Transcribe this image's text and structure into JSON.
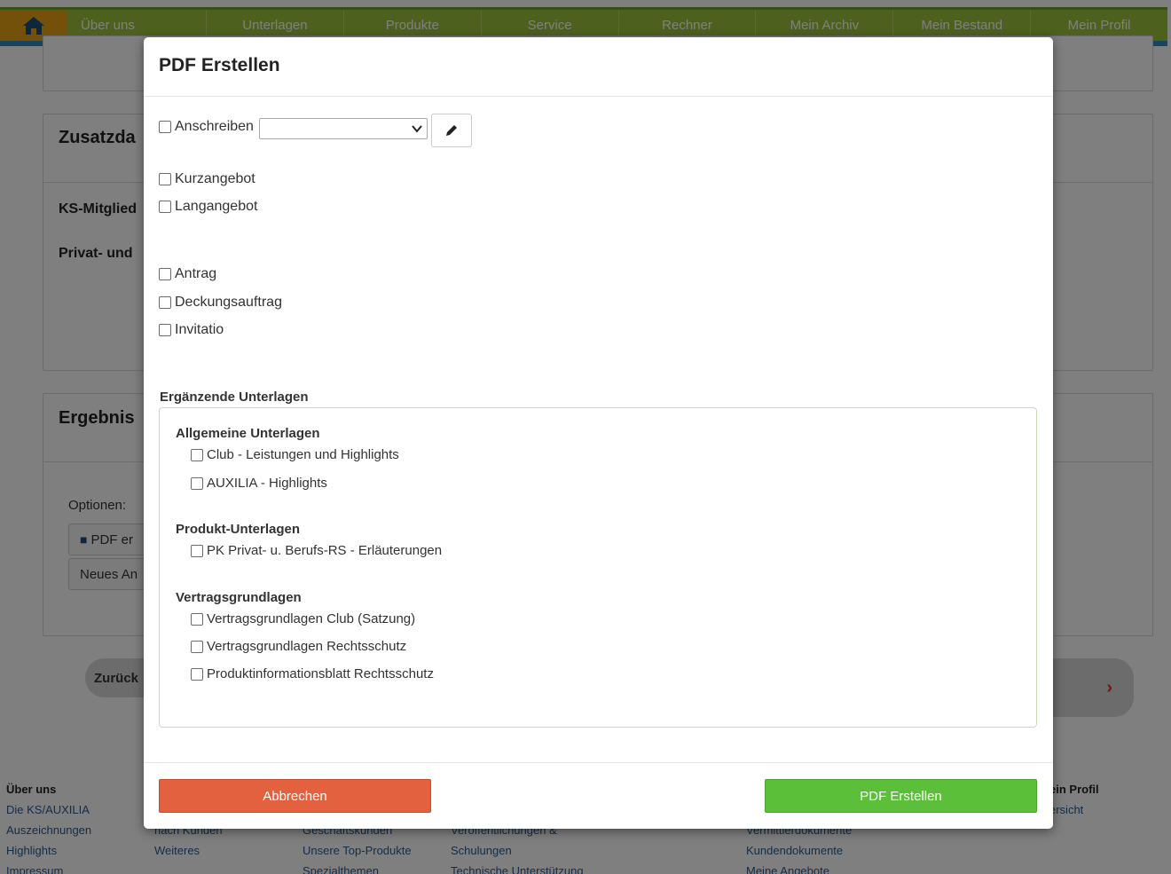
{
  "nav": {
    "items": [
      "Über uns",
      "Unterlagen",
      "Produkte",
      "Service",
      "Rechner",
      "Mein Archiv",
      "Mein Bestand",
      "Mein Profil"
    ]
  },
  "background": {
    "zusatz_heading": "Zusatzda",
    "ks_mitglied": "KS-Mitglied",
    "privat_und": "Privat- und",
    "ergebnis_heading": "Ergebnis",
    "optionen": "Optionen:",
    "pdf_btn": "PDF er",
    "neues_btn": "Neues An",
    "zurueck": "Zurück",
    "arrow": "›"
  },
  "footer": {
    "col1": {
      "heading": "Über uns",
      "links": [
        "Die KS/AUXILIA",
        "Auszeichnungen",
        "Highlights",
        "Impressum"
      ]
    },
    "col2": {
      "links": [
        "nach Kunden",
        "Weiteres"
      ]
    },
    "col3": {
      "links": [
        "Geschäftskunden",
        "Unsere Top-Produkte",
        "Spezialthemen"
      ]
    },
    "col4": {
      "links": [
        "Veröffentlichungen &",
        "Schulungen",
        "Technische Unterstützung"
      ]
    },
    "col5": {
      "links": [
        "Vermittlerdokumente",
        "Kundendokumente",
        "Meine Angebote"
      ]
    },
    "col6": {
      "heading": "ein Profil",
      "links": [
        "ersicht"
      ]
    }
  },
  "modal": {
    "title": "PDF Erstellen",
    "anschreiben_label": "Anschreiben",
    "anschreiben_value": "",
    "options_a": [
      "Kurzangebot",
      "Langangebot"
    ],
    "options_b": [
      "Antrag",
      "Deckungsauftrag",
      "Invitatio"
    ],
    "extra_heading": "Ergänzende Unterlagen",
    "groups": [
      {
        "title": "Allgemeine Unterlagen",
        "items": [
          "Club - Leistungen und Highlights",
          "AUXILIA - Highlights"
        ]
      },
      {
        "title": "Produkt-Unterlagen",
        "items": [
          "PK Privat- u. Berufs-RS - Erläuterungen"
        ]
      },
      {
        "title": "Vertragsgrundlagen",
        "items": [
          "Vertragsgrundlagen Club (Satzung)",
          "Vertragsgrundlagen Rechtsschutz",
          "Produktinformationsblatt Rechtsschutz"
        ]
      }
    ],
    "cancel_label": "Abbrechen",
    "create_label": "PDF Erstellen",
    "colors": {
      "cancel": "#e4613f",
      "create": "#5bbf3a",
      "nav": "#9cc13c",
      "home": "#e8a317"
    }
  }
}
